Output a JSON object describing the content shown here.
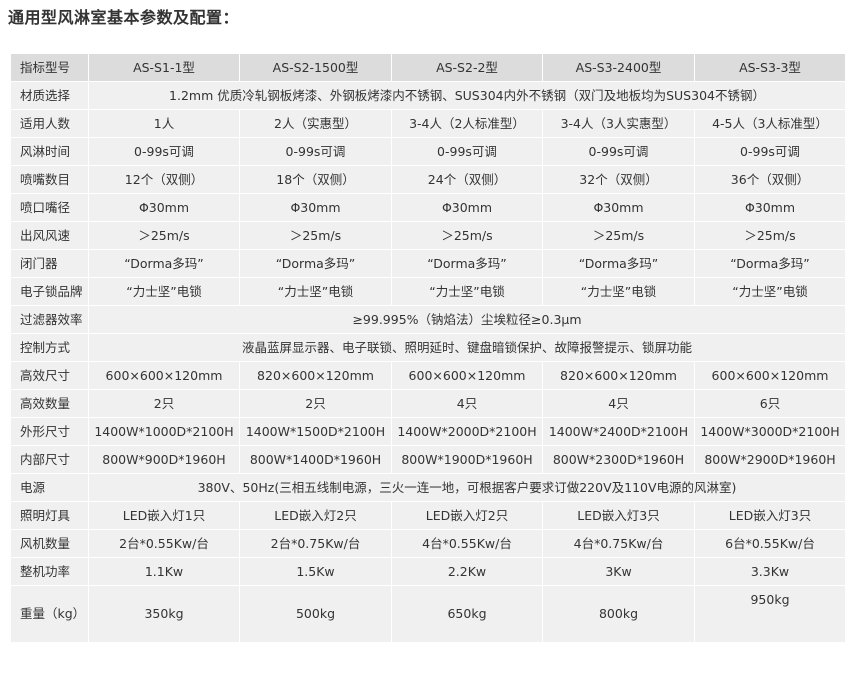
{
  "page": {
    "title": "通用型风淋室基本参数及配置："
  },
  "table": {
    "header": {
      "label": "指标型号",
      "models": [
        "AS-S1-1型",
        "AS-S2-1500型",
        "AS-S2-2型",
        "AS-S3-2400型",
        "AS-S3-3型"
      ]
    },
    "rows": [
      {
        "label": "材质选择",
        "span": "1.2mm 优质冷轧钢板烤漆、外钢板烤漆内不锈钢、SUS304内外不锈钢（双门及地板均为SUS304不锈钢）"
      },
      {
        "label": "适用人数",
        "cells": [
          "1人",
          "2人（实惠型）",
          "3-4人（2人标准型）",
          "3-4人（3人实惠型）",
          "4-5人（3人标准型）"
        ]
      },
      {
        "label": "风淋时间",
        "cells": [
          "0-99s可调",
          "0-99s可调",
          "0-99s可调",
          "0-99s可调",
          "0-99s可调"
        ]
      },
      {
        "label": "喷嘴数目",
        "cells": [
          "12个（双侧）",
          "18个（双侧）",
          "24个（双侧）",
          "32个（双侧）",
          "36个（双侧）"
        ]
      },
      {
        "label": "喷口嘴径",
        "cells": [
          "Φ30mm",
          "Φ30mm",
          "Φ30mm",
          "Φ30mm",
          "Φ30mm"
        ]
      },
      {
        "label": "出风风速",
        "cells": [
          "＞25m/s",
          "＞25m/s",
          "＞25m/s",
          "＞25m/s",
          "＞25m/s"
        ]
      },
      {
        "label": "闭门器",
        "cells": [
          "“Dorma多玛”",
          "“Dorma多玛”",
          "“Dorma多玛”",
          "“Dorma多玛”",
          "“Dorma多玛”"
        ]
      },
      {
        "label": "电子锁品牌",
        "cells": [
          "“力士坚”电锁",
          "“力士坚”电锁",
          "“力士坚”电锁",
          "“力士坚”电锁",
          "“力士坚”电锁"
        ]
      },
      {
        "label": "过滤器效率",
        "span": "≥99.995%（钠焰法）尘埃粒径≥0.3μm"
      },
      {
        "label": "控制方式",
        "span": "液晶蓝屏显示器、电子联锁、照明延时、键盘暗锁保护、故障报警提示、锁屏功能"
      },
      {
        "label": "高效尺寸",
        "cells": [
          "600×600×120mm",
          "820×600×120mm",
          "600×600×120mm",
          "820×600×120mm",
          "600×600×120mm"
        ]
      },
      {
        "label": "高效数量",
        "cells": [
          "2只",
          "2只",
          "4只",
          "4只",
          "6只"
        ]
      },
      {
        "label": "外形尺寸",
        "cells": [
          "1400W*1000D*2100H",
          "1400W*1500D*2100H",
          "1400W*2000D*2100H",
          "1400W*2400D*2100H",
          "1400W*3000D*2100H"
        ]
      },
      {
        "label": "内部尺寸",
        "cells": [
          "800W*900D*1960H",
          "800W*1400D*1960H",
          "800W*1900D*1960H",
          "800W*2300D*1960H",
          "800W*2900D*1960H"
        ]
      },
      {
        "label": "电源",
        "span": "380V、50Hz(三相五线制电源，三火一连一地，可根据客户要求订做220V及110V电源的风淋室)"
      },
      {
        "label": "照明灯具",
        "cells": [
          "LED嵌入灯1只",
          "LED嵌入灯2只",
          "LED嵌入灯2只",
          "LED嵌入灯3只",
          "LED嵌入灯3只"
        ]
      },
      {
        "label": "风机数量",
        "cells": [
          "2台*0.55Kw/台",
          "2台*0.75Kw/台",
          "4台*0.55Kw/台",
          "4台*0.75Kw/台",
          "6台*0.55Kw/台"
        ]
      },
      {
        "label": "整机功率",
        "cells": [
          "1.1Kw",
          "1.5Kw",
          "2.2Kw",
          "3Kw",
          "3.3Kw"
        ]
      },
      {
        "label": "重量（kg）",
        "cells": [
          "350kg",
          "500kg",
          "650kg",
          "800kg",
          "950kg"
        ]
      }
    ]
  }
}
